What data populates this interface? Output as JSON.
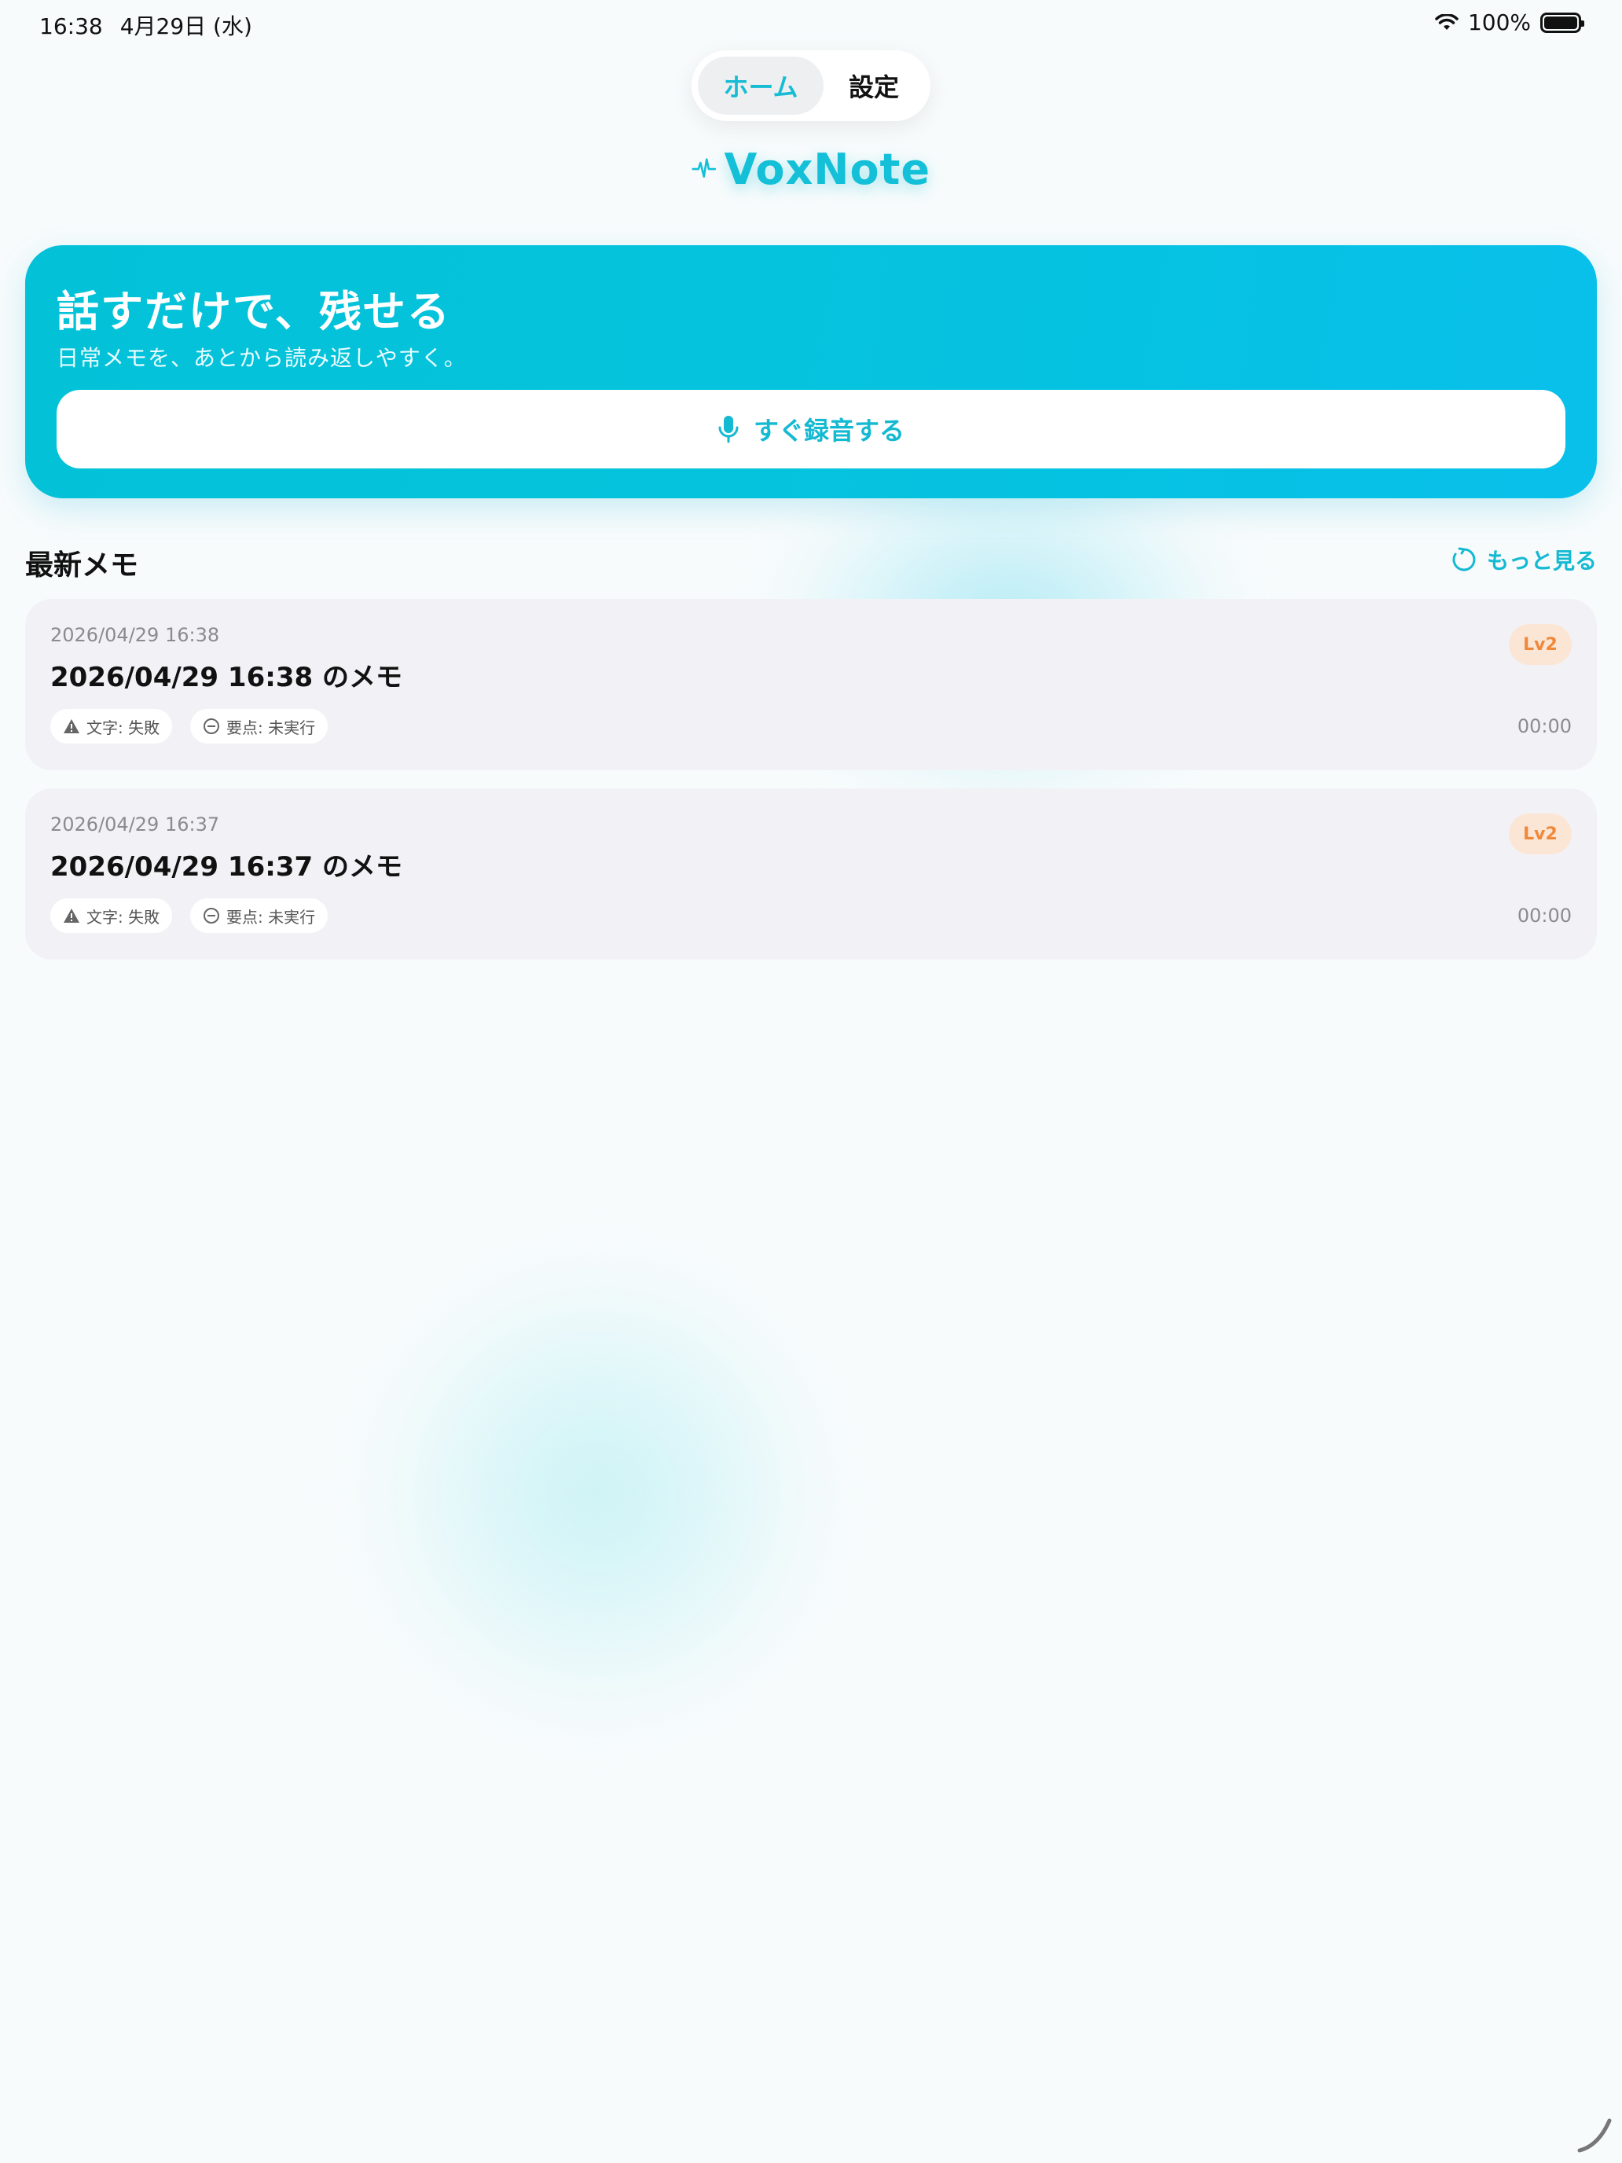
{
  "status_bar": {
    "time": "16:38",
    "date": "4月29日 (水)",
    "battery": "100%"
  },
  "tabs": [
    {
      "label": "ホーム",
      "selected": true
    },
    {
      "label": "設定",
      "selected": false
    }
  ],
  "app": {
    "logo_text": "VoxNote",
    "logo_icon": "waveform-icon",
    "accent_color": "#13c0d8"
  },
  "hero": {
    "title": "話すだけで、残せる",
    "subtitle": "日常メモを、あとから読み返しやすく。",
    "record_button_label": "すぐ録音する",
    "record_icon": "microphone-icon"
  },
  "latest": {
    "section_title": "最新メモ",
    "more_label": "もっと見る",
    "more_icon": "refresh-icon"
  },
  "memos": [
    {
      "timestamp": "2026/04/29 16:38",
      "title": "2026/04/29 16:38 のメモ",
      "level": "Lv2",
      "transcript_status": "文字: 失敗",
      "summary_status": "要点: 未実行",
      "duration": "00:00"
    },
    {
      "timestamp": "2026/04/29 16:37",
      "title": "2026/04/29 16:37 のメモ",
      "level": "Lv2",
      "transcript_status": "文字: 失敗",
      "summary_status": "要点: 未実行",
      "duration": "00:00"
    }
  ]
}
